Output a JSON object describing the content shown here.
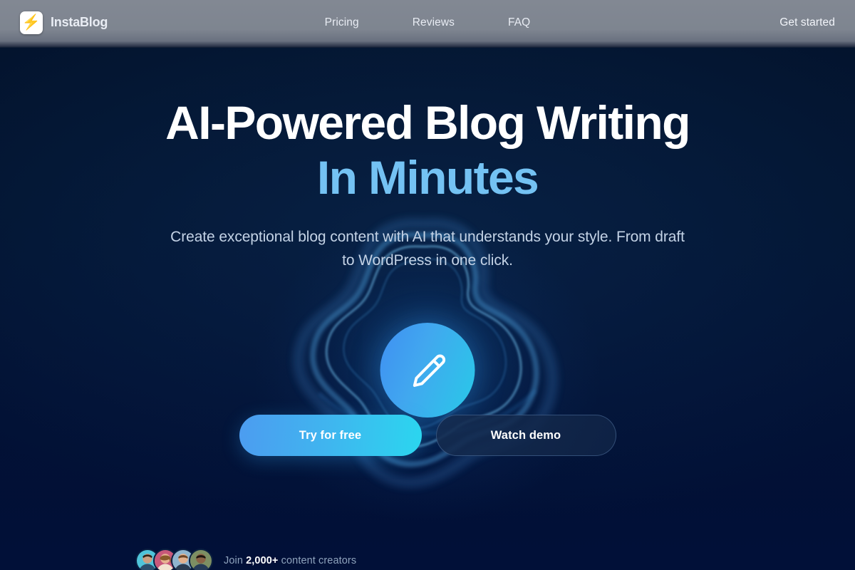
{
  "navbar": {
    "logo_icon": "lightning-bolt-icon",
    "logo_glyph": "⚡",
    "brand": "InstaBlog",
    "links": [
      {
        "label": "Pricing"
      },
      {
        "label": "Reviews"
      },
      {
        "label": "FAQ"
      }
    ],
    "cta": "Get started"
  },
  "hero": {
    "headline_line1": "AI-Powered Blog Writing",
    "headline_line2": "In Minutes",
    "subtitle": "Create exceptional blog content with AI that understands your style. From draft to WordPress in one click.",
    "feature_icon": "pen-icon",
    "primary_button": "Try for free",
    "secondary_button": "Watch demo"
  },
  "social_proof": {
    "prefix": "Join",
    "count": "2,000+",
    "suffix": "content creators",
    "avatars": [
      {
        "name": "avatar-1",
        "skin": "#caa083",
        "hair": "#2e2218",
        "bg": "#4fc4da",
        "shirt": "#2b4f6e"
      },
      {
        "name": "avatar-2",
        "skin": "#e8b492",
        "hair": "#8a5a2b",
        "bg": "#c8587a",
        "shirt": "#f2e3d0"
      },
      {
        "name": "avatar-3",
        "skin": "#e2b18e",
        "hair": "#6b4526",
        "bg": "#8fb5cf",
        "shirt": "#2a3c52"
      },
      {
        "name": "avatar-4",
        "skin": "#8a6346",
        "hair": "#1d1510",
        "bg": "#7d8f63",
        "shirt": "#253b57"
      }
    ]
  },
  "colors": {
    "background_top": "#03132c",
    "background_bottom": "#011038",
    "navbar": "#828893",
    "accent_light_blue": "#74c2f3",
    "accent_gradient_start": "#4c9cf0",
    "accent_gradient_end": "#2bd6ef",
    "body_text": "#c4d3e6",
    "muted_text": "#8fa3bd"
  }
}
